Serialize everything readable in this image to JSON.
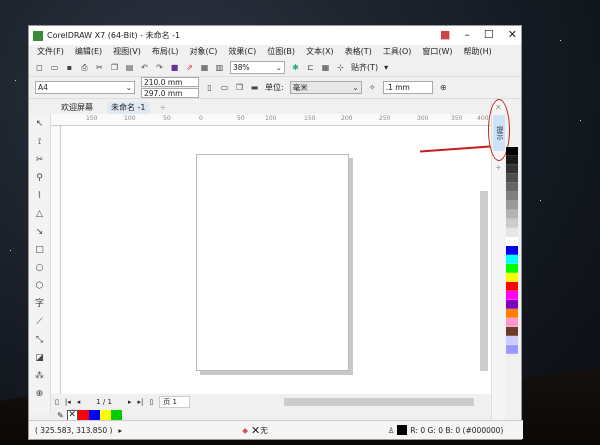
{
  "window": {
    "title": "CorelDRAW X7 (64-Bit) - 未命名 -1"
  },
  "menu": [
    "文件(F)",
    "编辑(E)",
    "视图(V)",
    "布局(L)",
    "对象(C)",
    "效果(C)",
    "位图(B)",
    "文本(X)",
    "表格(T)",
    "工具(O)",
    "窗口(W)",
    "帮助(H)"
  ],
  "toolbar": {
    "zoom": "38%",
    "snap_label": "贴齐(T)"
  },
  "property_bar": {
    "page_size": "A4",
    "width": "210.0 mm",
    "height": "297.0 mm",
    "unit_label": "单位:",
    "unit": "毫米",
    "nudge": ".1 mm"
  },
  "tabs": [
    "欢迎屏幕",
    "未命名 -1"
  ],
  "ruler_labels": [
    "150",
    "100",
    "50",
    "0",
    "50",
    "100",
    "150",
    "200",
    "250",
    "300",
    "350",
    "400"
  ],
  "docker": {
    "hint_tab": "提示"
  },
  "page_nav": {
    "counter": "1 / 1",
    "page_tab": "页 1"
  },
  "document_palette": [
    "#ff0000",
    "#0000ff",
    "#ffff00",
    "#00cc00"
  ],
  "palette": [
    "#000000",
    "#1a1a1a",
    "#333333",
    "#4d4d4d",
    "#666666",
    "#808080",
    "#999999",
    "#b3b3b3",
    "#cccccc",
    "#e6e6e6",
    "#ffffff",
    "#0000ff",
    "#00ffff",
    "#00ff00",
    "#ffff00",
    "#ff0000",
    "#ff00ff",
    "#8000c0",
    "#ff8000",
    "#ff99cc",
    "#6b3a2a",
    "#ccccff",
    "#9999ff"
  ],
  "status": {
    "coords": "( 325.583, 313.850 )",
    "fill": "无",
    "outline": "R: 0 G: 0 B: 0 (#000000)"
  }
}
